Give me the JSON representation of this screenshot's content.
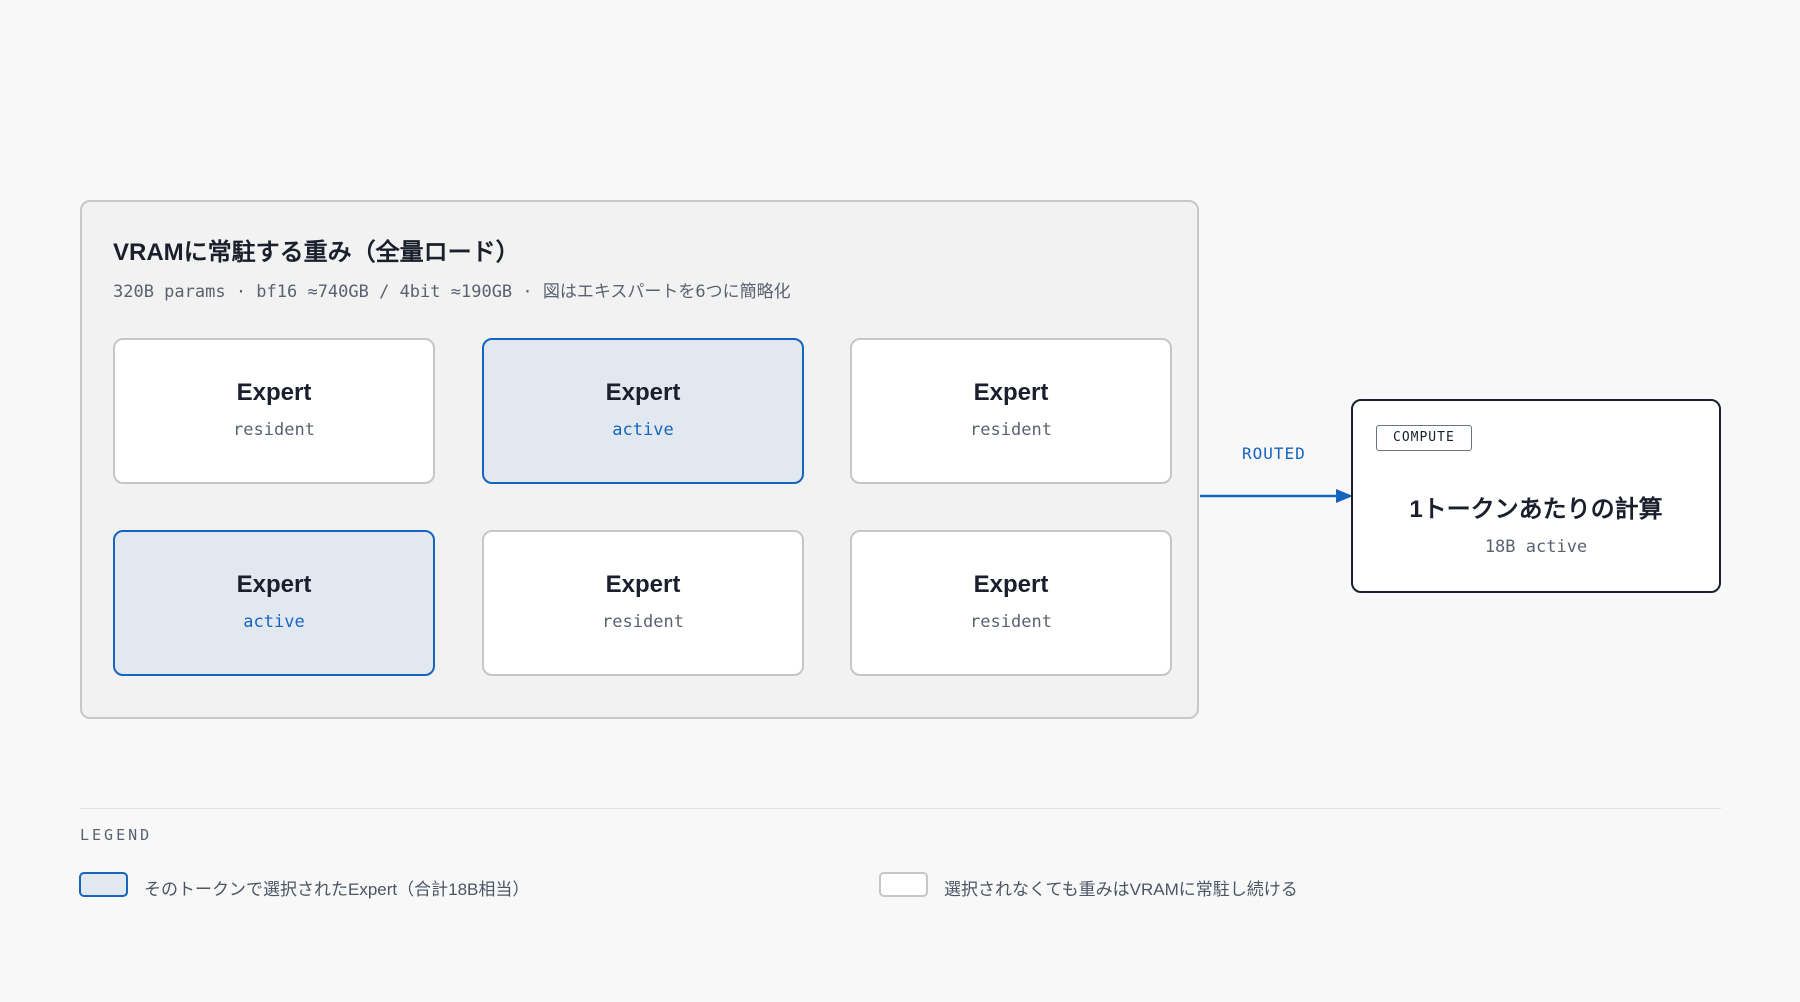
{
  "vram_panel": {
    "title": "VRAMに常駐する重み（全量ロード）",
    "subtitle": "320B params · bf16 ≈740GB / 4bit ≈190GB · 図はエキスパートを6つに簡略化"
  },
  "experts": [
    {
      "name": "Expert",
      "state": "resident"
    },
    {
      "name": "Expert",
      "state": "active"
    },
    {
      "name": "Expert",
      "state": "resident"
    },
    {
      "name": "Expert",
      "state": "active"
    },
    {
      "name": "Expert",
      "state": "resident"
    },
    {
      "name": "Expert",
      "state": "resident"
    }
  ],
  "route": {
    "label": "ROUTED"
  },
  "compute": {
    "badge": "COMPUTE",
    "title": "1トークンあたりの計算",
    "subtitle": "18B active"
  },
  "legend": {
    "title": "LEGEND",
    "active_text": "そのトークンで選択されたExpert（合計18B相当）",
    "resident_text": "選択されなくても重みはVRAMに常駐し続ける"
  },
  "colors": {
    "accent": "#1565c0",
    "active_fill": "#e2e8f0",
    "resident_border": "#c6c6c6",
    "panel_fill": "#f2f2f2",
    "text": "#1a1f2b"
  }
}
